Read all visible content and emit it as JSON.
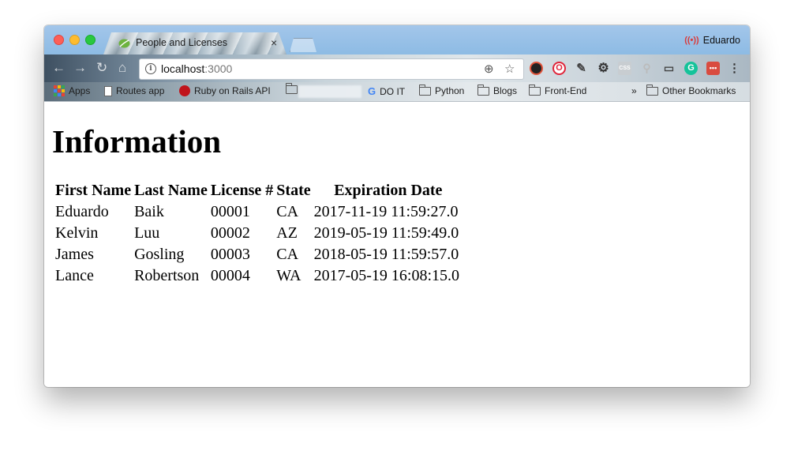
{
  "browser": {
    "tab_title": "People and Licenses",
    "tab_close": "×",
    "profile_name": "Eduardo",
    "url_host": "localhost",
    "url_port": ":3000"
  },
  "bookmarks": {
    "apps": "Apps",
    "routes": "Routes app",
    "rails": "Ruby on Rails API",
    "doit": "DO IT",
    "python": "Python",
    "blogs": "Blogs",
    "frontend": "Front-End",
    "overflow": "»",
    "other": "Other Bookmarks"
  },
  "page": {
    "heading": "Information",
    "columns": [
      "First Name",
      "Last Name",
      "License #",
      "State",
      "Expiration Date"
    ],
    "rows": [
      [
        "Eduardo",
        "Baik",
        "00001",
        "CA",
        "2017-11-19 11:59:27.0"
      ],
      [
        "Kelvin",
        "Luu",
        "00002",
        "AZ",
        "2019-05-19 11:59:49.0"
      ],
      [
        "James",
        "Gosling",
        "00003",
        "CA",
        "2018-05-19 11:59:57.0"
      ],
      [
        "Lance",
        "Robertson",
        "00004",
        "WA",
        "2017-05-19 16:08:15.0"
      ]
    ]
  },
  "colors": {
    "close": "#fd5f57",
    "minimize": "#febc2e",
    "maximize": "#28c840",
    "titlebar": "#9ec4e8"
  },
  "icons": [
    "back-icon",
    "forward-icon",
    "reload-icon",
    "home-icon",
    "info-icon",
    "zoom-icon",
    "star-icon",
    "menu-icon"
  ]
}
